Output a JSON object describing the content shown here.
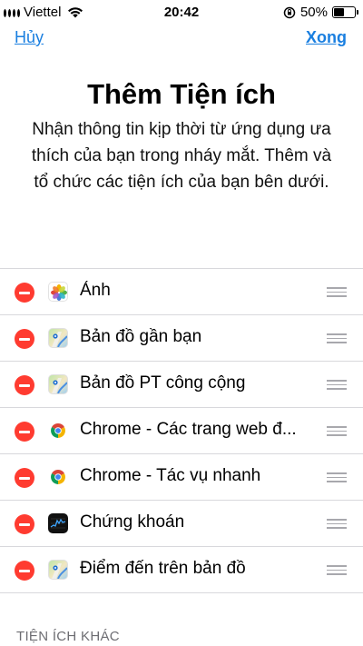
{
  "status": {
    "carrier": "Viettel",
    "time": "20:42",
    "battery": "50%",
    "battery_level": 0.5
  },
  "nav": {
    "cancel": "Hủy",
    "done": "Xong"
  },
  "header": {
    "title": "Thêm Tiện ích",
    "description": "Nhận thông tin kịp thời từ ứng dụng ưa thích của bạn trong nháy mắt. Thêm và tổ chức các tiện ích của bạn bên dưới."
  },
  "widgets": [
    {
      "label": "Ảnh",
      "icon": "photos-icon"
    },
    {
      "label": "Bản đồ gần bạn",
      "icon": "maps-icon"
    },
    {
      "label": "Bản đồ PT công cộng",
      "icon": "maps-icon"
    },
    {
      "label": "Chrome - Các trang web đ...",
      "icon": "chrome-icon"
    },
    {
      "label": "Chrome - Tác vụ nhanh",
      "icon": "chrome-icon"
    },
    {
      "label": "Chứng khoán",
      "icon": "stocks-icon"
    },
    {
      "label": "Điểm đến trên bản đồ",
      "icon": "maps-icon"
    }
  ],
  "more_section": {
    "title": "TIỆN ÍCH KHÁC"
  },
  "colors": {
    "link": "#1a7fe0",
    "remove": "#ff3b30",
    "separator": "#d8d8dc"
  }
}
